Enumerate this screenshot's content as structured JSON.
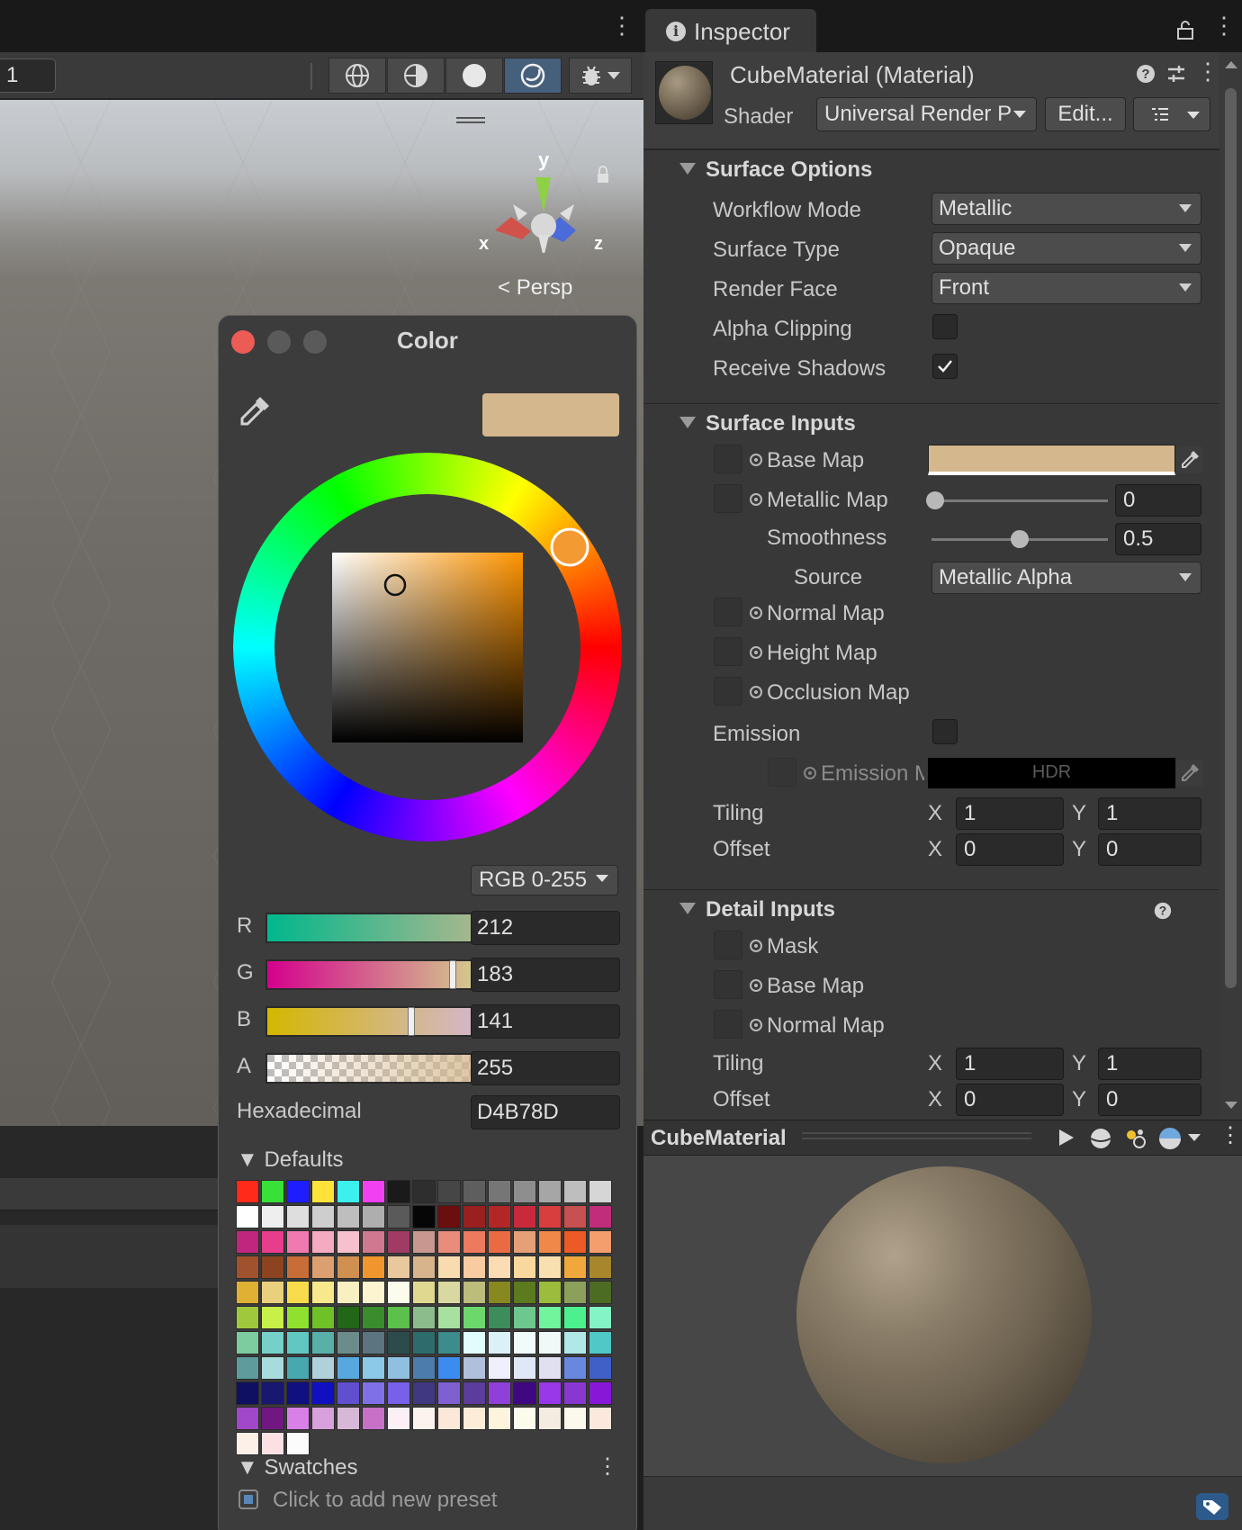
{
  "scene": {
    "layer_value": "1",
    "persp_label": "Persp",
    "gizmo": {
      "x": "x",
      "y": "y",
      "z": "z"
    }
  },
  "color_picker": {
    "title": "Color",
    "preview_color": "#D4B78D",
    "mode": "RGB 0-255",
    "channels": [
      {
        "label": "R",
        "value": "212",
        "fraction": 0.831
      },
      {
        "label": "G",
        "value": "183",
        "fraction": 0.718
      },
      {
        "label": "B",
        "value": "141",
        "fraction": 0.553
      },
      {
        "label": "A",
        "value": "255",
        "fraction": 1.0
      }
    ],
    "hex_label": "Hexadecimal",
    "hex_value": "D4B78D",
    "defaults_label": "Defaults",
    "swatches_label": "Swatches",
    "add_preset": "Click to add new preset",
    "default_colors": [
      "#ff2a1a",
      "#38e038",
      "#1d1dff",
      "#ffe23a",
      "#3cf0f0",
      "#f040f0",
      "#1a1a1a",
      "#2e2e2e",
      "#464646",
      "#5e5e5e",
      "#767676",
      "#8e8e8e",
      "#a6a6a6",
      "#bebebe",
      "#d6d6d6",
      "#ffffff",
      "#eeeeee",
      "#dedede",
      "#cecece",
      "#bebebe",
      "#aeaeae",
      "#5a5a5a",
      "#060606",
      "#6a0e0e",
      "#9a2020",
      "#b22626",
      "#c82a3c",
      "#d83e3e",
      "#c85050",
      "#c02e7a",
      "#c0267e",
      "#e83c8c",
      "#f07ab0",
      "#f4aac0",
      "#f6c0cc",
      "#d07890",
      "#a03c64",
      "#c89890",
      "#e88c7c",
      "#ec7a5c",
      "#ea6a44",
      "#e6a078",
      "#f08848",
      "#ec5a26",
      "#f49e6e",
      "#a0522d",
      "#8c4420",
      "#c86c38",
      "#dca070",
      "#d09050",
      "#f0962c",
      "#e8c89c",
      "#d8b48c",
      "#f8dcb0",
      "#f8cca0",
      "#fcdcb4",
      "#f8d89c",
      "#f8e0b0",
      "#f0a83c",
      "#a8862c",
      "#e0b034",
      "#e8d07c",
      "#f8dc4c",
      "#f8e88c",
      "#f8f0c0",
      "#fcf4d0",
      "#fcfcec",
      "#e0d890",
      "#d8d8a0",
      "#bcbc7c",
      "#888820",
      "#5c7a1e",
      "#9cbc3c",
      "#8ca05c",
      "#4c6c24",
      "#a0c83c",
      "#c8f048",
      "#90e030",
      "#70c028",
      "#226618",
      "#3a8c2c",
      "#5cc04c",
      "#8cbc8c",
      "#a8e0a0",
      "#6cd86c",
      "#3c8c5c",
      "#6cc88c",
      "#70f49c",
      "#4cf08c",
      "#84f4c4",
      "#7ccca0",
      "#74d0c8",
      "#60c8c0",
      "#58b0a8",
      "#6c8c8c",
      "#5c7480",
      "#2c4c4c",
      "#2c6c6c",
      "#3c8c8c",
      "#e0fcfc",
      "#dcf0f8",
      "#f0fcfc",
      "#f0f8f8",
      "#b0e8e8",
      "#50c8c8",
      "#5c9c9c",
      "#a8dcdc",
      "#48a8b0",
      "#b0d0dc",
      "#58a8e0",
      "#8cc8e8",
      "#90c0e0",
      "#4c7cac",
      "#3c8cf0",
      "#b0c0dc",
      "#f0f0fc",
      "#e0e8f8",
      "#e0e0f0",
      "#6888e0",
      "#4060c8",
      "#101060",
      "#181870",
      "#101080",
      "#1010c0",
      "#6050d0",
      "#8070e8",
      "#7860e8",
      "#403880",
      "#8060d0",
      "#5c3c9c",
      "#9040d8",
      "#400880",
      "#9838e8",
      "#8838d0",
      "#8818d8",
      "#a048c8",
      "#701880",
      "#d880e8",
      "#d8a0dc",
      "#d8b8d8",
      "#c870c8",
      "#fcf0f4",
      "#fcf4ec",
      "#fce8d8",
      "#fcecd8",
      "#fcf4dc",
      "#fcfcec",
      "#f4ece0",
      "#fcf8ec",
      "#fce8dc",
      "#fdf0e8",
      "#fce0e4",
      "#fcfcfc"
    ]
  },
  "inspector": {
    "tab_label": "Inspector",
    "material_name": "CubeMaterial (Material)",
    "shader_label": "Shader",
    "shader_value": "Universal Render P",
    "edit_button": "Edit...",
    "surface_options": {
      "title": "Surface Options",
      "workflow_mode_label": "Workflow Mode",
      "workflow_mode": "Metallic",
      "surface_type_label": "Surface Type",
      "surface_type": "Opaque",
      "render_face_label": "Render Face",
      "render_face": "Front",
      "alpha_clipping_label": "Alpha Clipping",
      "alpha_clipping": false,
      "receive_shadows_label": "Receive Shadows",
      "receive_shadows": true
    },
    "surface_inputs": {
      "title": "Surface Inputs",
      "base_map_label": "Base Map",
      "base_color": "#D4B78D",
      "metallic_map_label": "Metallic Map",
      "metallic_value": "0",
      "metallic_fraction": 0.0,
      "smoothness_label": "Smoothness",
      "smoothness_value": "0.5",
      "smoothness_fraction": 0.5,
      "source_label": "Source",
      "source_value": "Metallic Alpha",
      "normal_map_label": "Normal Map",
      "height_map_label": "Height Map",
      "occlusion_map_label": "Occlusion Map",
      "emission_label": "Emission",
      "emission_enabled": false,
      "emission_map_label": "Emission M",
      "emission_hdr": "HDR",
      "tiling_label": "Tiling",
      "tiling_x": "1",
      "tiling_y": "1",
      "offset_label": "Offset",
      "offset_x": "0",
      "offset_y": "0"
    },
    "detail_inputs": {
      "title": "Detail Inputs",
      "mask_label": "Mask",
      "base_map_label": "Base Map",
      "normal_map_label": "Normal Map",
      "tiling_label": "Tiling",
      "tiling_x": "1",
      "tiling_y": "1",
      "offset_label": "Offset",
      "offset_x": "0",
      "offset_y": "0"
    },
    "axis_x": "X",
    "axis_y": "Y",
    "preview_title": "CubeMaterial"
  }
}
